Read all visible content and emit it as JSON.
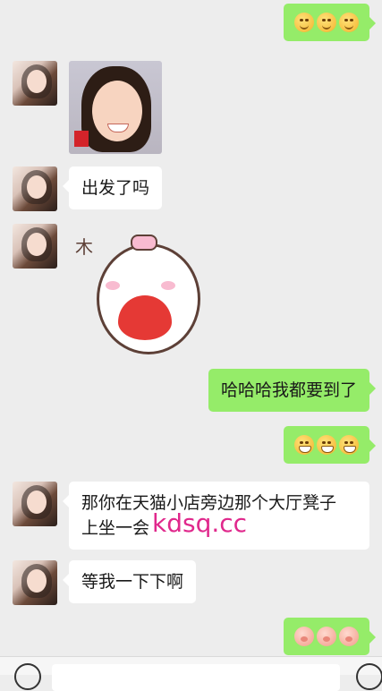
{
  "messages": [
    {
      "side": "right",
      "type": "emoji",
      "emojis": [
        "smile",
        "smile",
        "smile"
      ]
    },
    {
      "side": "left",
      "type": "image"
    },
    {
      "side": "left",
      "type": "text",
      "text": "出发了吗"
    },
    {
      "side": "left",
      "type": "sticker",
      "mark": "木"
    },
    {
      "side": "right",
      "type": "text",
      "text": "哈哈哈我都要到了"
    },
    {
      "side": "right",
      "type": "emoji",
      "emojis": [
        "grin",
        "grin",
        "grin"
      ]
    },
    {
      "side": "left",
      "type": "text",
      "text": "那你在天猫小店旁边那个大厅凳子\n上坐一会"
    },
    {
      "side": "left",
      "type": "text",
      "text": "等我一下下啊"
    },
    {
      "side": "right",
      "type": "emoji",
      "emojis": [
        "pig",
        "pig",
        "pig"
      ]
    }
  ],
  "watermark": "kdsq.cc",
  "colors": {
    "background": "#ededed",
    "bubble_right": "#95ec69",
    "bubble_left": "#ffffff",
    "watermark": "#e0288c"
  }
}
